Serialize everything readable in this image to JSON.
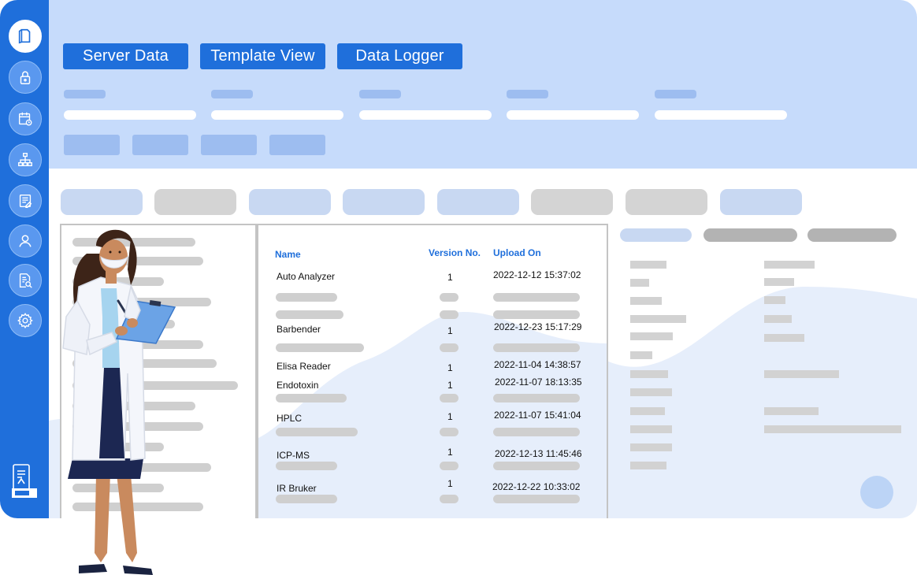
{
  "sidebar": {
    "icons": [
      "documents-icon",
      "lock-icon",
      "calendar-clock-icon",
      "org-chart-icon",
      "report-icon",
      "user-icon",
      "search-document-icon",
      "settings-icon"
    ],
    "bottom_icon": "mobile-document-icon"
  },
  "header": {
    "tabs": [
      {
        "label": "Server Data"
      },
      {
        "label": "Template View"
      },
      {
        "label": "Data Logger"
      }
    ]
  },
  "table": {
    "columns": {
      "name": "Name",
      "version": "Version No.",
      "upload": "Upload On"
    },
    "rows": [
      {
        "name": "Auto Analyzer",
        "version": "1",
        "upload": "2022-12-12 15:37:02"
      },
      {
        "name": "Barbender",
        "version": "1",
        "upload": "2022-12-23 15:17:29"
      },
      {
        "name": "Elisa Reader",
        "version": "1",
        "upload": "2022-11-04 14:38:57"
      },
      {
        "name": "Endotoxin",
        "version": "1",
        "upload": "2022-11-07 18:13:35"
      },
      {
        "name": "HPLC",
        "version": "1",
        "upload": "2022-11-07 15:41:04"
      },
      {
        "name": "ICP-MS",
        "version": "1",
        "upload": "2022-12-13 11:45:46"
      },
      {
        "name": "IR Bruker",
        "version": "1",
        "upload": "2022-12-22 10:33:02"
      }
    ]
  },
  "colors": {
    "primary": "#1f6fdb",
    "header_bg": "#c6dbfb",
    "placeholder_grey": "#cfcfcf",
    "placeholder_blue": "#c8d8f2"
  }
}
